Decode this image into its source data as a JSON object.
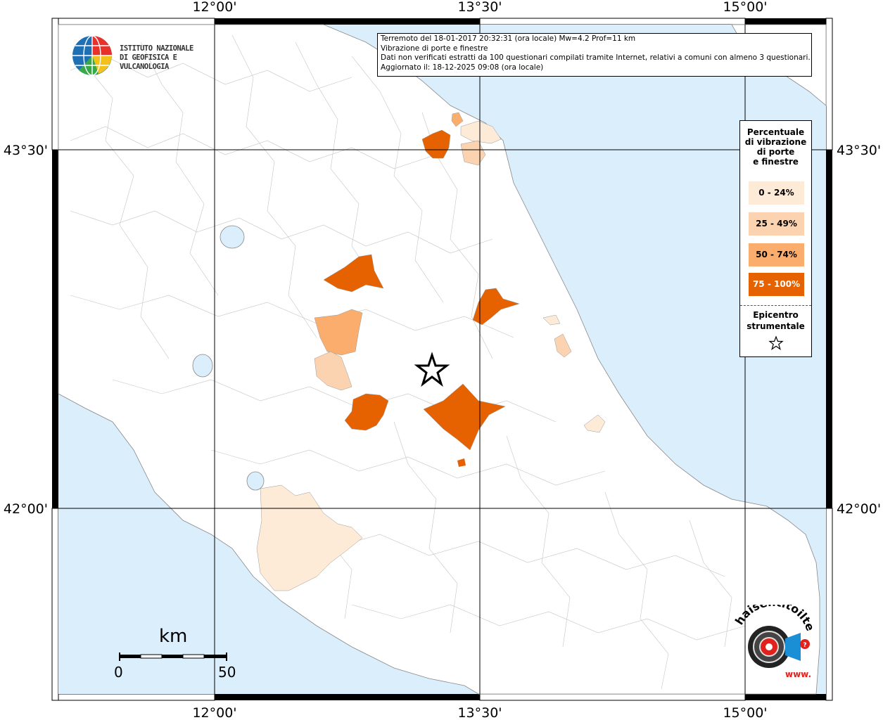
{
  "axes": {
    "top_lon_labels": [
      "12°00'",
      "13°30'",
      "15°00'"
    ],
    "bottom_lon_labels": [
      "12°00'",
      "13°30'",
      "15°00'"
    ],
    "left_lat_labels": [
      "43°30'",
      "42°00'"
    ],
    "right_lat_labels": [
      "43°30'",
      "42°00'"
    ]
  },
  "info_box": {
    "line1": "Terremoto del 18-01-2017 20:32:31 (ora locale) Mw=4.2 Prof=11 km",
    "line2": "Vibrazione di porte e finestre",
    "line3": "Dati non verificati estratti da 100 questionari compilati tramite Internet, relativi a comuni con almeno 3 questionari.",
    "line4": "Aggiornato il: 18-12-2025 09:08 (ora locale)"
  },
  "legend": {
    "title_line1": "Percentuale",
    "title_line2": "di vibrazione",
    "title_line3": "di porte",
    "title_line4": "e finestre",
    "items": [
      {
        "label": "0 - 24%",
        "color": "#fdebd7"
      },
      {
        "label": "25 - 49%",
        "color": "#fcd3b0"
      },
      {
        "label": "50 - 74%",
        "color": "#fbad6e"
      },
      {
        "label": "75 - 100%",
        "color": "#e66100"
      }
    ],
    "epicenter_line1": "Epicentro",
    "epicenter_line2": "strumentale"
  },
  "logo": {
    "line1": "ISTITUTO NAZIONALE",
    "line2": "DI GEOFISICA E VULCANOLOGIA"
  },
  "scale": {
    "unit": "km",
    "min_label": "0",
    "max_label": "50"
  },
  "hst_logo": {
    "name": "haisentitoilterremoto.it",
    "www": "www."
  },
  "colors": {
    "sea": "#dbeefb",
    "land": "#ffffff",
    "border": "#b0b0b0"
  }
}
